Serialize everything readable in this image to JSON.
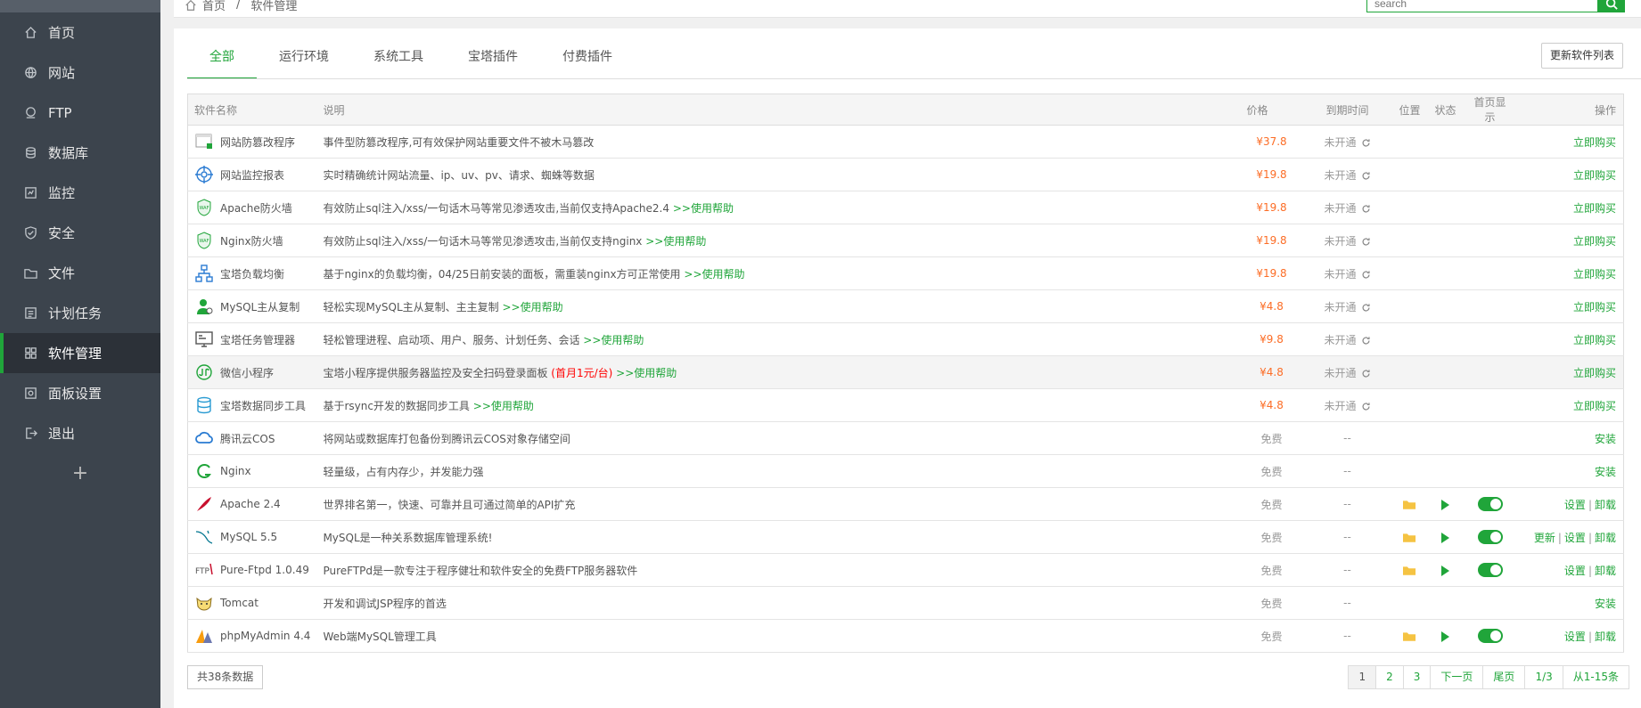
{
  "sidebar": {
    "items": [
      {
        "label": "首页",
        "icon": "home-icon"
      },
      {
        "label": "网站",
        "icon": "globe-icon"
      },
      {
        "label": "FTP",
        "icon": "ftp-icon"
      },
      {
        "label": "数据库",
        "icon": "database-icon"
      },
      {
        "label": "监控",
        "icon": "monitor-icon"
      },
      {
        "label": "安全",
        "icon": "shield-icon"
      },
      {
        "label": "文件",
        "icon": "folder-icon"
      },
      {
        "label": "计划任务",
        "icon": "list-icon"
      },
      {
        "label": "软件管理",
        "icon": "grid-icon",
        "active": true
      },
      {
        "label": "面板设置",
        "icon": "settings-icon"
      },
      {
        "label": "退出",
        "icon": "logout-icon"
      }
    ],
    "add_label": "+"
  },
  "breadcrumb": {
    "home": "首页",
    "sep": "/",
    "current": "软件管理"
  },
  "search": {
    "placeholder": "search"
  },
  "tabs": [
    "全部",
    "运行环境",
    "系统工具",
    "宝塔插件",
    "付费插件"
  ],
  "update_button": "更新软件列表",
  "table": {
    "headers": {
      "name": "软件名称",
      "desc": "说明",
      "price": "价格",
      "expire": "到期时间",
      "location": "位置",
      "status": "状态",
      "homepage": "首页显示",
      "action": "操作"
    },
    "rows": [
      {
        "name": "网站防篡改程序",
        "icon": "tamper-icon",
        "desc": "事件型防篡改程序,可有效保护网站重要文件不被木马篡改",
        "price": "¥37.8",
        "expire": "未开通",
        "actions": [
          "立即购买"
        ]
      },
      {
        "name": "网站监控报表",
        "icon": "monitor-report-icon",
        "desc": "实时精确统计网站流量、ip、uv、pv、请求、蜘蛛等数据",
        "price": "¥19.8",
        "expire": "未开通",
        "actions": [
          "立即购买"
        ]
      },
      {
        "name": "Apache防火墙",
        "icon": "waf-icon",
        "desc": "有效防止sql注入/xss/一句话木马等常见渗透攻击,当前仅支持Apache2.4",
        "help": ">>使用帮助",
        "price": "¥19.8",
        "expire": "未开通",
        "actions": [
          "立即购买"
        ]
      },
      {
        "name": "Nginx防火墙",
        "icon": "waf-icon",
        "desc": "有效防止sql注入/xss/一句话木马等常见渗透攻击,当前仅支持nginx",
        "help": ">>使用帮助",
        "price": "¥19.8",
        "expire": "未开通",
        "actions": [
          "立即购买"
        ]
      },
      {
        "name": "宝塔负载均衡",
        "icon": "load-balance-icon",
        "desc": "基于nginx的负载均衡，04/25日前安装的面板，需重装nginx方可正常使用",
        "help": ">>使用帮助",
        "price": "¥19.8",
        "expire": "未开通",
        "actions": [
          "立即购买"
        ]
      },
      {
        "name": "MySQL主从复制",
        "icon": "mysql-replication-icon",
        "desc": "轻松实现MySQL主从复制、主主复制",
        "help": ">>使用帮助",
        "price": "¥4.8",
        "expire": "未开通",
        "actions": [
          "立即购买"
        ]
      },
      {
        "name": "宝塔任务管理器",
        "icon": "task-manager-icon",
        "desc": "轻松管理进程、启动项、用户、服务、计划任务、会话",
        "help": ">>使用帮助",
        "price": "¥9.8",
        "expire": "未开通",
        "actions": [
          "立即购买"
        ]
      },
      {
        "name": "微信小程序",
        "icon": "wechat-mini-icon",
        "desc": "宝塔小程序提供服务器监控及安全扫码登录面板",
        "note": "(首月1元/台)",
        "help": ">>使用帮助",
        "price": "¥4.8",
        "expire": "未开通",
        "actions": [
          "立即购买"
        ],
        "highlight": true
      },
      {
        "name": "宝塔数据同步工具",
        "icon": "data-sync-icon",
        "desc": "基于rsync开发的数据同步工具",
        "help": ">>使用帮助",
        "price": "¥4.8",
        "expire": "未开通",
        "actions": [
          "立即购买"
        ]
      },
      {
        "name": "腾讯云COS",
        "icon": "tencent-cloud-icon",
        "desc": "将网站或数据库打包备份到腾讯云COS对象存储空间",
        "price": "免费",
        "expire": "--",
        "actions": [
          "安装"
        ]
      },
      {
        "name": "Nginx",
        "icon": "nginx-icon",
        "desc": "轻量级，占有内存少，并发能力强",
        "price": "免费",
        "expire": "--",
        "actions": [
          "安装"
        ]
      },
      {
        "name": "Apache 2.4",
        "icon": "apache-icon",
        "desc": "世界排名第一，快速、可靠并且可通过简单的API扩充",
        "price": "免费",
        "expire": "--",
        "installed": true,
        "actions": [
          "设置",
          "卸载"
        ]
      },
      {
        "name": "MySQL 5.5",
        "icon": "mysql-icon",
        "desc": "MySQL是一种关系数据库管理系统!",
        "price": "免费",
        "expire": "--",
        "installed": true,
        "actions": [
          "更新",
          "设置",
          "卸载"
        ]
      },
      {
        "name": "Pure-Ftpd 1.0.49",
        "icon": "ftp-logo-icon",
        "desc": "PureFTPd是一款专注于程序健壮和软件安全的免费FTP服务器软件",
        "price": "免费",
        "expire": "--",
        "installed": true,
        "actions": [
          "设置",
          "卸载"
        ]
      },
      {
        "name": "Tomcat",
        "icon": "tomcat-icon",
        "desc": "开发和调试JSP程序的首选",
        "price": "免费",
        "expire": "--",
        "actions": [
          "安装"
        ]
      },
      {
        "name": "phpMyAdmin 4.4",
        "icon": "phpmyadmin-icon",
        "desc": "Web端MySQL管理工具",
        "price": "免费",
        "expire": "--",
        "installed": true,
        "actions": [
          "设置",
          "卸载"
        ]
      }
    ]
  },
  "total": "共38条数据",
  "pager": [
    "1",
    "2",
    "3",
    "下一页",
    "尾页",
    "1/3",
    "从1-15条"
  ],
  "colors": {
    "accent": "#20a53a",
    "price": "#fc6d26",
    "sidebar": "#3c444d"
  }
}
